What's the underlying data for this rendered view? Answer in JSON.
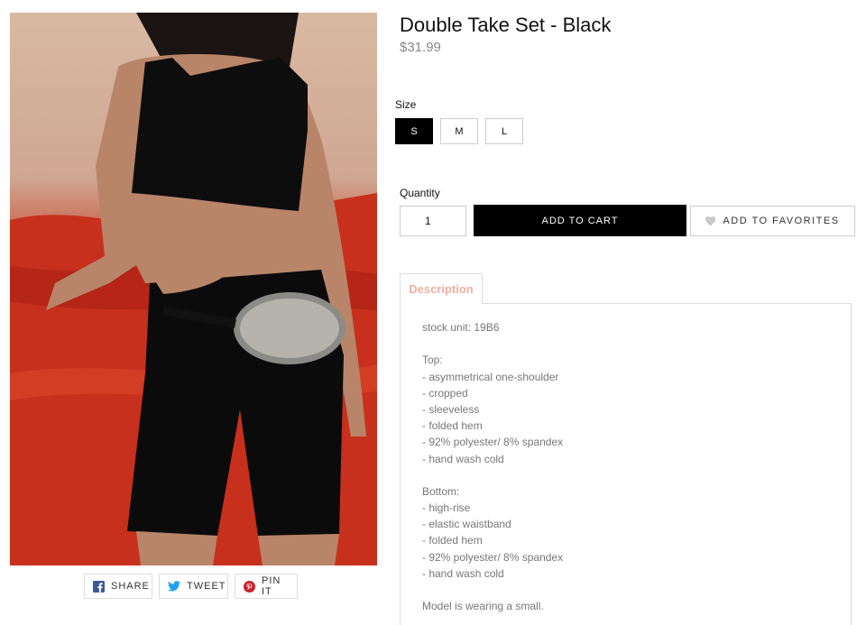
{
  "product": {
    "title": "Double Take Set - Black",
    "price": "$31.99"
  },
  "size": {
    "label": "Size",
    "options": [
      "S",
      "M",
      "L"
    ],
    "selected": "S"
  },
  "quantity": {
    "label": "Quantity",
    "value": "1"
  },
  "actions": {
    "add_to_cart": "ADD TO CART",
    "add_to_favorites": "ADD TO FAVORITES"
  },
  "tabs": {
    "description": "Description"
  },
  "description": {
    "sku": "stock unit: 19B6",
    "top_heading": "Top:",
    "top_items": [
      "- asymmetrical one-shoulder",
      "- cropped",
      "- sleeveless",
      "- folded hem",
      "- 92% polyester/ 8% spandex",
      "- hand wash cold"
    ],
    "bottom_heading": "Bottom:",
    "bottom_items": [
      "- high-rise",
      "- elastic waistband",
      "- folded hem",
      "- 92% polyester/ 8% spandex",
      "- hand wash cold"
    ],
    "model_note": "Model is wearing a small."
  },
  "share": {
    "share": "SHARE",
    "tweet": "TWEET",
    "pin": "PIN IT"
  },
  "colors": {
    "facebook": "#3b5998",
    "twitter": "#1da1f2",
    "pinterest": "#cb2027",
    "tab_accent": "#f0b09d"
  }
}
